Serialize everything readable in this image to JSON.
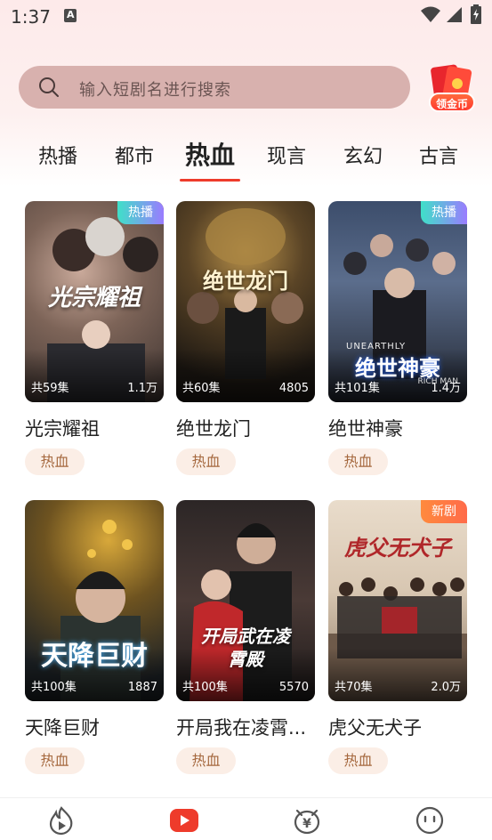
{
  "status": {
    "time": "1:37"
  },
  "search": {
    "placeholder": "输入短剧名进行搜索"
  },
  "coin": {
    "label": "领金币"
  },
  "tabs": [
    "热播",
    "都市",
    "热血",
    "现言",
    "玄幻",
    "古言"
  ],
  "active_tab": "热血",
  "colors": {
    "accent": "#ee3b2b",
    "tag_bg": "#fbeee6",
    "tag_text": "#a5683e",
    "search_bg": "#d8b1ae"
  },
  "dramas": [
    {
      "title": "光宗耀祖",
      "episodes": "共59集",
      "views": "1.1万",
      "badge": "热播",
      "tag": "热血",
      "art_text": "光宗耀祖"
    },
    {
      "title": "绝世龙门",
      "episodes": "共60集",
      "views": "4805",
      "badge": "",
      "tag": "热血",
      "art_text": "绝世龙门"
    },
    {
      "title": "绝世神豪",
      "episodes": "共101集",
      "views": "1.4万",
      "badge": "热播",
      "tag": "热血",
      "art_text": "绝世神豪",
      "art_sub": "UNEARTHLY",
      "art_sub2": "RICH MAN"
    },
    {
      "title": "天降巨财",
      "episodes": "共100集",
      "views": "1887",
      "badge": "",
      "tag": "热血",
      "art_text": "天降巨财"
    },
    {
      "title": "开局我在凌霄...",
      "episodes": "共100集",
      "views": "5570",
      "badge": "",
      "tag": "热血",
      "art_text": "开局武在凌霄殿"
    },
    {
      "title": "虎父无犬子",
      "episodes": "共70集",
      "views": "2.0万",
      "badge": "新剧",
      "tag": "热血",
      "art_text": "虎父无犬子"
    }
  ],
  "bottom_nav": [
    {
      "icon": "fire-play-icon"
    },
    {
      "icon": "video-play-icon"
    },
    {
      "icon": "piggy-bank-icon"
    },
    {
      "icon": "smile-face-icon"
    }
  ]
}
